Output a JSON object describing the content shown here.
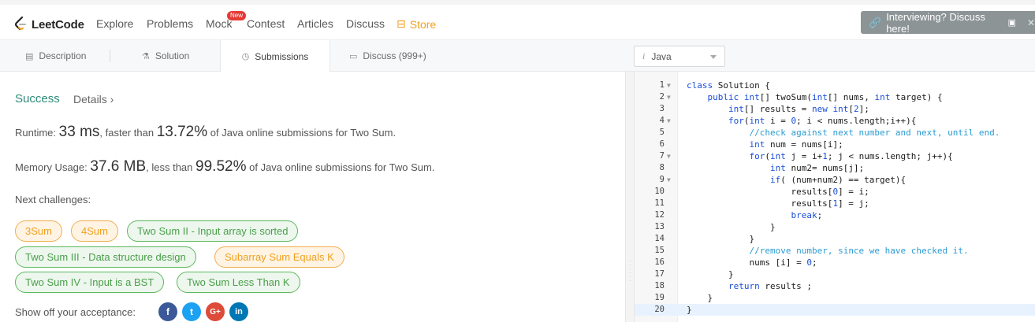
{
  "nav": {
    "logo": "LeetCode",
    "links": [
      "Explore",
      "Problems",
      "Mock",
      "Contest",
      "Articles",
      "Discuss"
    ],
    "new_badge": "New",
    "store": "Store",
    "interview_banner": "Interviewing? Discuss here!"
  },
  "tabs": [
    "Description",
    "Solution",
    "Submissions",
    "Discuss (999+)"
  ],
  "active_tab": "Submissions",
  "language": "Java",
  "result": {
    "status": "Success",
    "details_link": "Details ›",
    "runtime": {
      "label": "Runtime:",
      "value": "33 ms",
      "middle": ", faster than",
      "percent": "13.72%",
      "suffix": "of Java online submissions for Two Sum."
    },
    "memory": {
      "label": "Memory Usage:",
      "value": "37.6 MB",
      "middle": ", less than",
      "percent": "99.52%",
      "suffix": "of Java online submissions for Two Sum."
    }
  },
  "next_challenges": {
    "label": "Next challenges:",
    "items": [
      {
        "label": "3Sum",
        "difficulty": "medium"
      },
      {
        "label": "4Sum",
        "difficulty": "medium"
      },
      {
        "label": "Two Sum II - Input array is sorted",
        "difficulty": "easy"
      },
      {
        "label": "Two Sum III - Data structure design",
        "difficulty": "easy"
      },
      {
        "label": "Subarray Sum Equals K",
        "difficulty": "medium"
      },
      {
        "label": "Two Sum IV - Input is a BST",
        "difficulty": "easy"
      },
      {
        "label": "Two Sum Less Than K",
        "difficulty": "easy"
      }
    ]
  },
  "share": {
    "label": "Show off your acceptance:",
    "networks": [
      "facebook-icon",
      "twitter-icon",
      "google-plus-icon",
      "linkedin-icon"
    ]
  },
  "colors": {
    "success": "#2e8b7a",
    "medium": "#f0a020",
    "easy": "#4a9e4a",
    "facebook": "#3b5998",
    "twitter": "#1da1f2",
    "google": "#dd4b39",
    "linkedin": "#0077b5"
  },
  "code": {
    "lines": [
      "class Solution {",
      "    public int[] twoSum(int[] nums, int target) {",
      "        int[] results = new int[2];",
      "        for(int i = 0; i < nums.length;i++){",
      "            //check against next number and next, until end.",
      "            int num = nums[i];",
      "            for(int j = i+1; j < nums.length; j++){",
      "                int num2= nums[j];",
      "                if( (num+num2) == target){",
      "                    results[0] = i;",
      "                    results[1] = j;",
      "                    break;",
      "                }",
      "            }",
      "            //remove number, since we have checked it.",
      "            nums [i] = 0;",
      "        }",
      "        return results ;",
      "    }",
      "}"
    ],
    "folds": [
      1,
      2,
      4,
      7,
      9
    ]
  }
}
